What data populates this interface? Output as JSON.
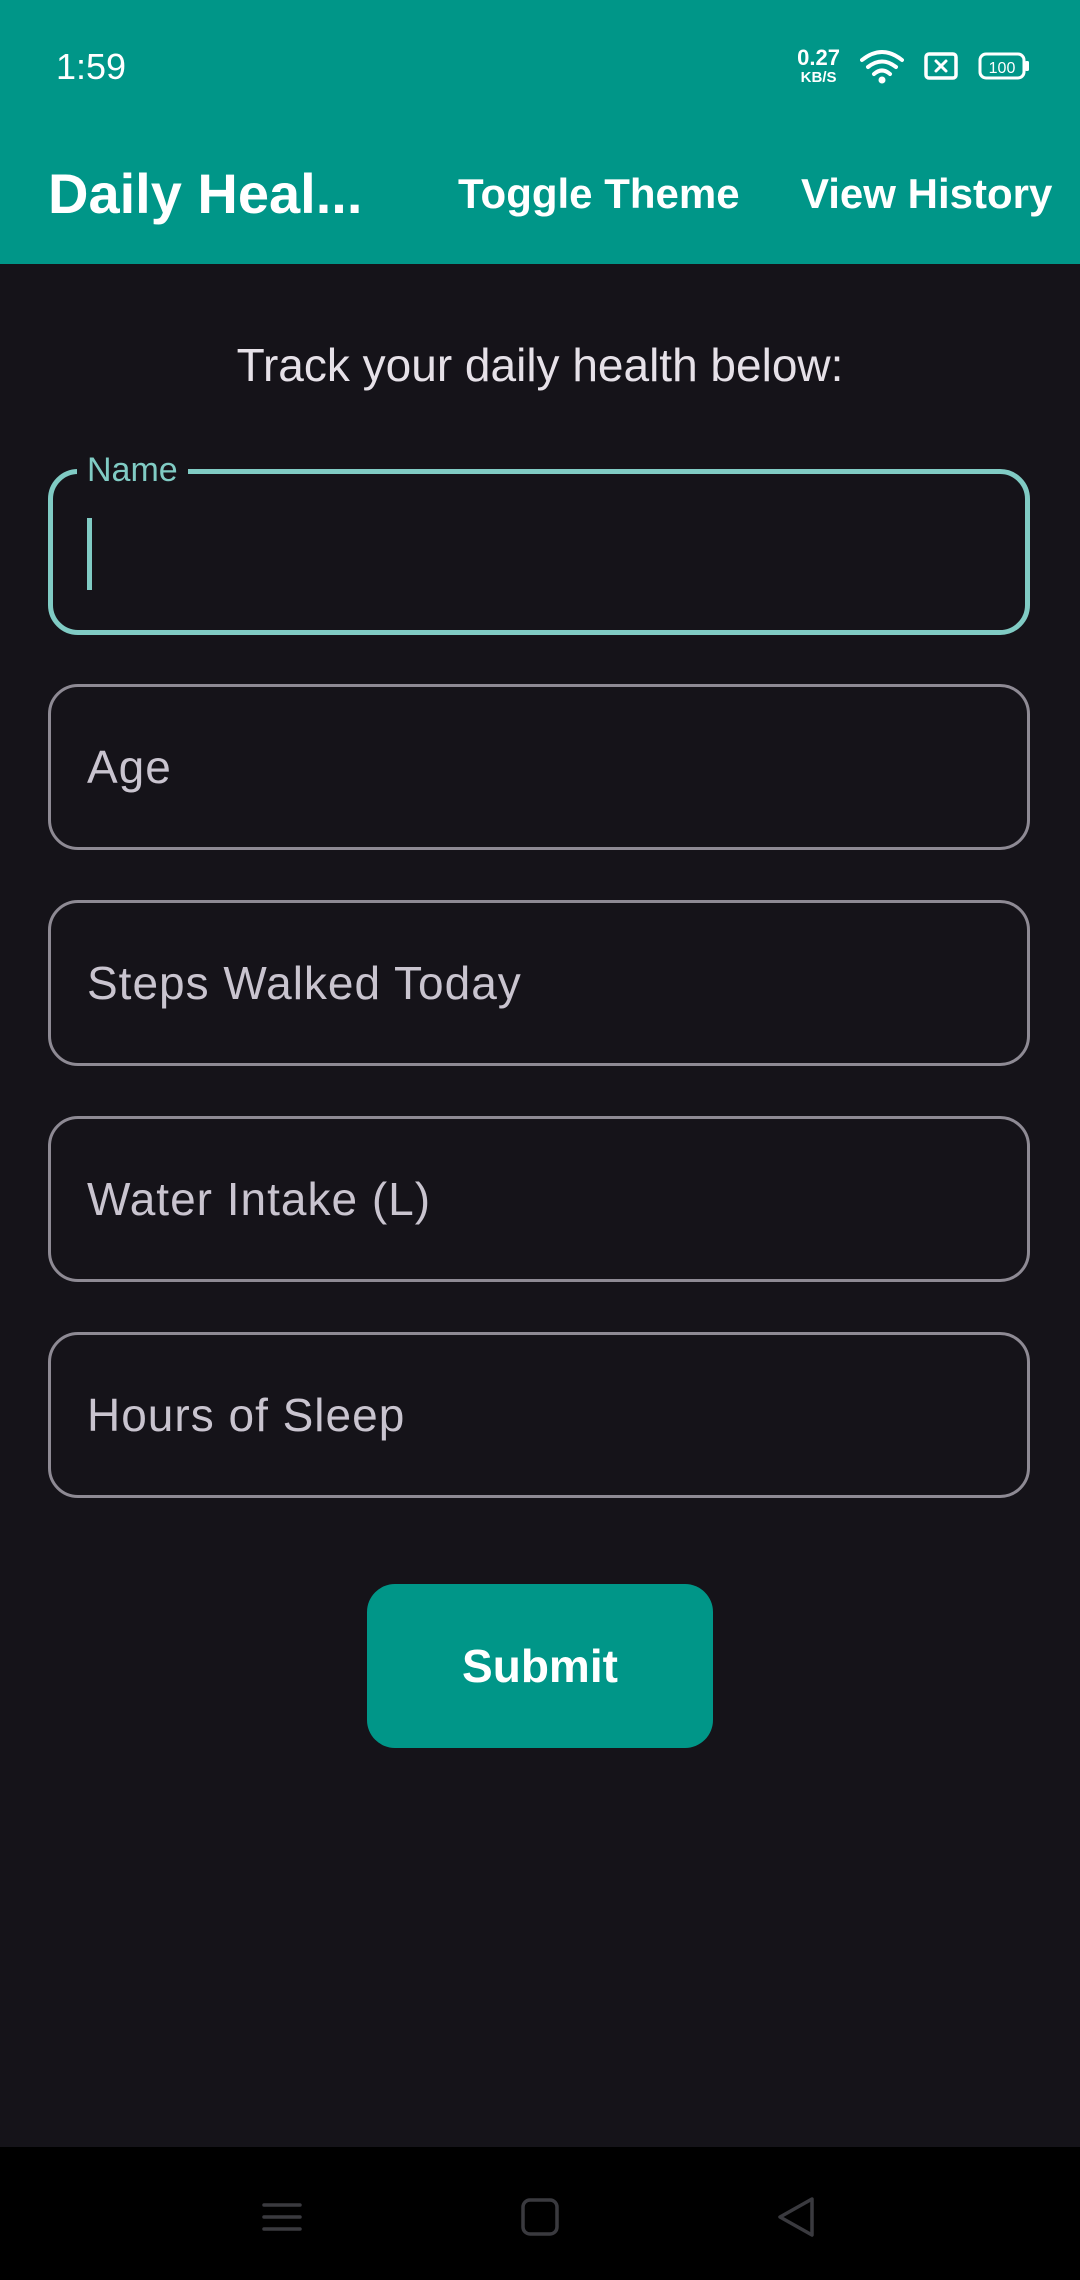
{
  "status_bar": {
    "time": "1:59",
    "net_speed_value": "0.27",
    "net_speed_unit": "KB/S",
    "battery": "100",
    "icons": [
      "wifi-icon",
      "sim-icon",
      "battery-icon"
    ]
  },
  "app_bar": {
    "title": "Daily Heal...",
    "toggle_theme_label": "Toggle Theme",
    "view_history_label": "View History"
  },
  "main": {
    "subtitle": "Track your daily health below:",
    "fields": {
      "name_label": "Name",
      "name_value": "",
      "age_placeholder": "Age",
      "steps_placeholder": "Steps Walked Today",
      "water_placeholder": "Water Intake (L)",
      "sleep_placeholder": "Hours of Sleep"
    },
    "submit_label": "Submit"
  },
  "nav_bar": {
    "buttons": [
      "menu-icon",
      "home-icon",
      "back-icon"
    ]
  },
  "colors": {
    "primary": "#009688",
    "accent": "#80cbc4",
    "background": "#151319"
  }
}
